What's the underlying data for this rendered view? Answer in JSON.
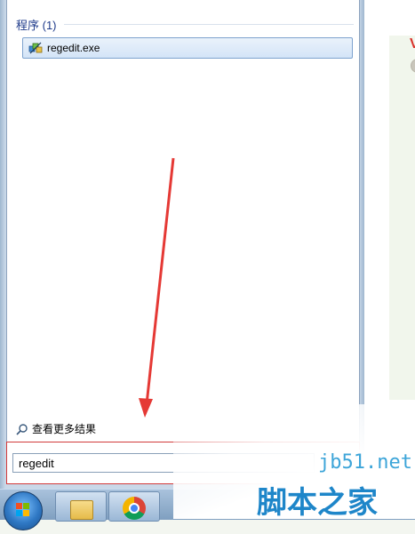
{
  "start_menu": {
    "section_title": "程序 (1)",
    "results": [
      {
        "label": "regedit.exe",
        "icon": "registry-editor-icon"
      }
    ],
    "see_more_label": "查看更多结果",
    "search_value": "regedit"
  },
  "taskbar": {
    "buttons": [
      {
        "name": "start-button",
        "icon": "windows-orb-icon"
      },
      {
        "name": "explorer-button",
        "icon": "folder-icon"
      },
      {
        "name": "chrome-button",
        "icon": "chrome-icon"
      }
    ]
  },
  "watermark": {
    "site": "jb51.net",
    "name": "脚本之家"
  },
  "colors": {
    "accent": "#1e3a8a",
    "annotation_red": "#e53935",
    "watermark_blue": "#1e86c9"
  }
}
